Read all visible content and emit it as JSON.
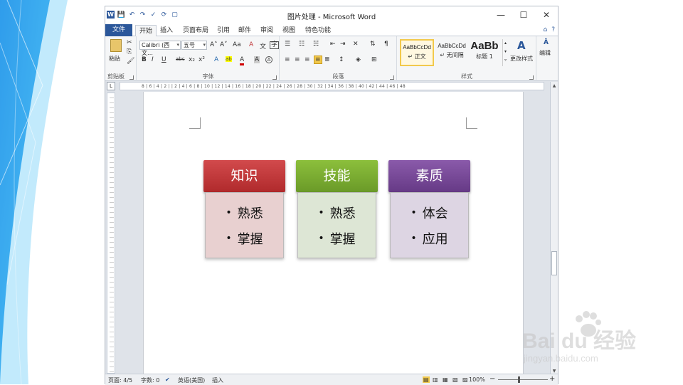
{
  "window": {
    "title": "图片处理 - Microsoft Word",
    "qat": [
      "W",
      "💾",
      "↶",
      "↷",
      "✓",
      "⟳",
      "▢"
    ],
    "controls": {
      "minimize": "—",
      "maximize": "☐",
      "close": "✕"
    }
  },
  "tabs": {
    "file": "文件",
    "items": [
      "开始",
      "插入",
      "页面布局",
      "引用",
      "邮件",
      "审阅",
      "视图",
      "特色功能"
    ],
    "right": [
      "⌂",
      "?"
    ]
  },
  "ribbon": {
    "clipboard": {
      "label": "剪贴板",
      "paste": "粘贴"
    },
    "font": {
      "label": "字体",
      "font_name": "Calibri (西文…",
      "font_size": "五号",
      "bold": "B",
      "italic": "I",
      "underline": "U",
      "strike": "abc",
      "sub": "x₂",
      "sup": "x²",
      "grow": "A˄",
      "shrink": "A˅",
      "case": "Aa",
      "clear": "A",
      "highlight": "ab",
      "color": "A",
      "charborder": "A",
      "charshade": "A",
      "phonetic": "文",
      "enclose": "字"
    },
    "paragraph": {
      "label": "段落"
    },
    "styles": {
      "label": "样式",
      "items": [
        {
          "sample": "AaBbCcDd",
          "name": "↵ 正文"
        },
        {
          "sample": "AaBbCcDd",
          "name": "↵ 无间隔"
        },
        {
          "sample": "AaBb",
          "name": "标题 1"
        }
      ],
      "change": "更改样式"
    },
    "editing": {
      "label": "编辑"
    }
  },
  "ruler": {
    "ticks": "8 | 6 | 4 | 2 | | 2 | 4 | 6 | 8 | 10 | 12 | 14 | 16 | 18 | 20 | 22 | 24 | 26 | 28 | 30 | 32 | 34 | 36 | 38 | 40 | 42 | 44 | 46 | 48",
    "corner": "L"
  },
  "document": {
    "cards": [
      {
        "title": "知识",
        "bullets": [
          "熟悉",
          "掌握"
        ],
        "head_color": "#c0393b",
        "body_color": "#e8d0d0"
      },
      {
        "title": "技能",
        "bullets": [
          "熟悉",
          "掌握"
        ],
        "head_color": "#78a832",
        "body_color": "#dde6d5"
      },
      {
        "title": "素质",
        "bullets": [
          "体会",
          "应用"
        ],
        "head_color": "#7a4a9a",
        "body_color": "#ddd5e3"
      }
    ]
  },
  "statusbar": {
    "page": "页面: 4/5",
    "words": "字数: 0",
    "lang": "英语(美国)",
    "mode": "插入",
    "zoom": "100%",
    "zoom_minus": "−",
    "zoom_plus": "+"
  },
  "watermark": {
    "main": "Bai du 经验",
    "sub": "jingyan.baidu.com"
  },
  "colors": {
    "accent": "#2b579a"
  }
}
